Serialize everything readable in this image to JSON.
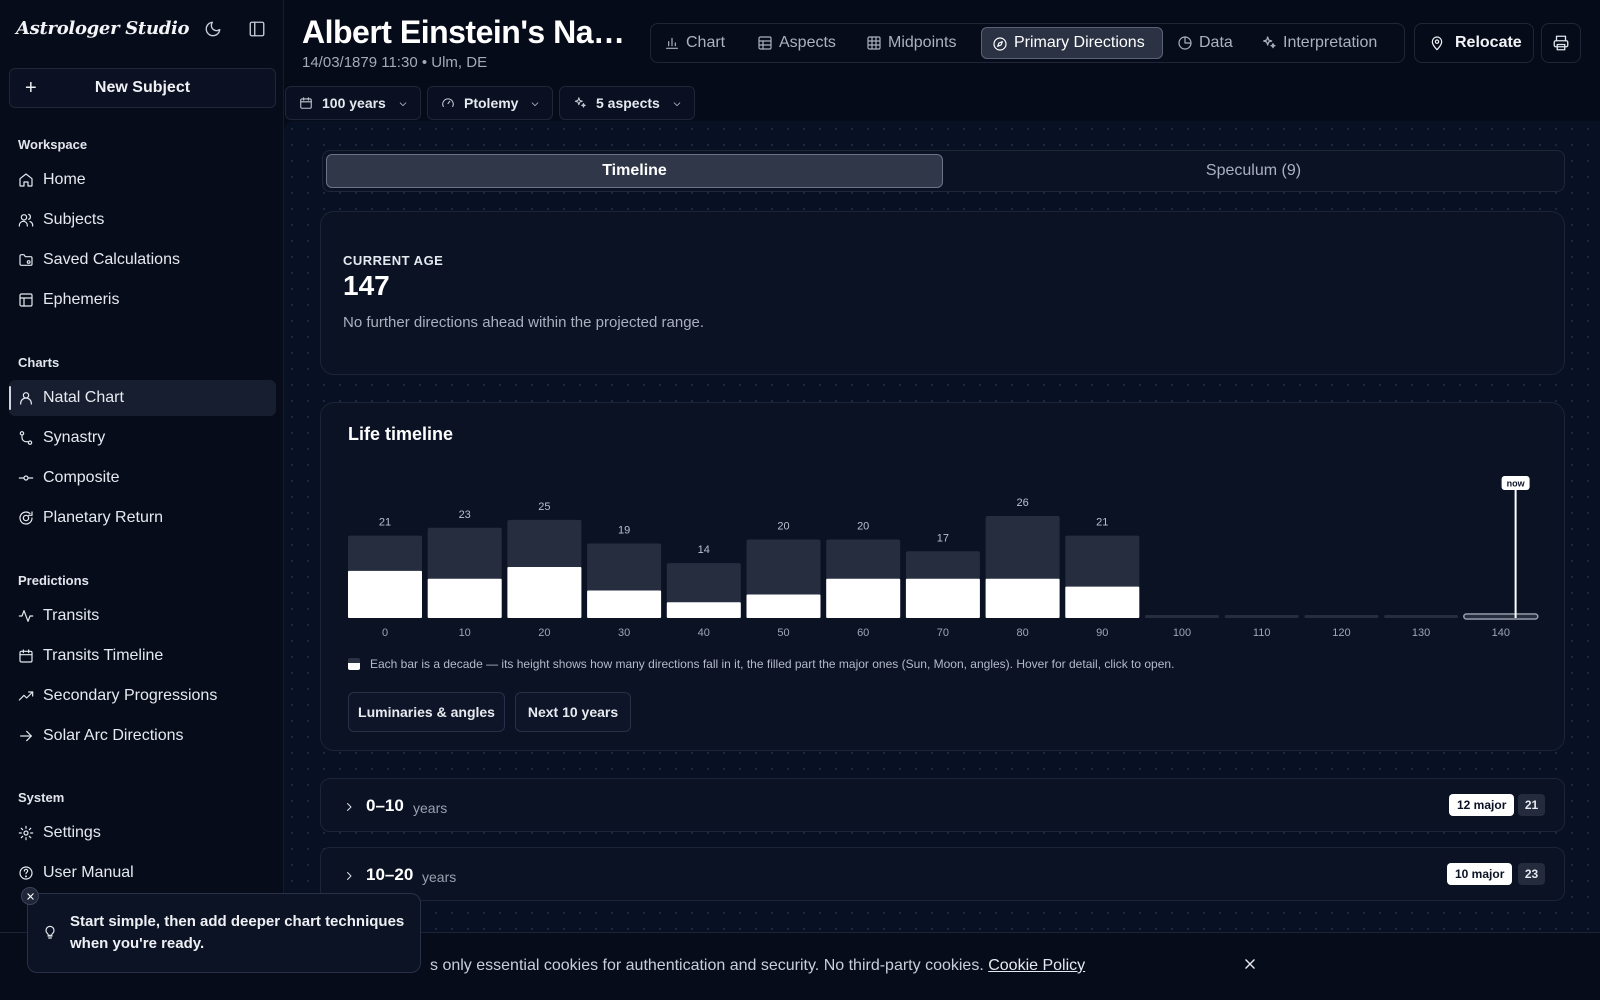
{
  "app": {
    "brand": "Astrologer Studio"
  },
  "sidebar": {
    "new_subject": "New Subject",
    "sections": {
      "workspace": "Workspace",
      "charts": "Charts",
      "predictions": "Predictions",
      "system": "System"
    },
    "workspace_items": [
      {
        "label": "Home",
        "icon": "home-icon"
      },
      {
        "label": "Subjects",
        "icon": "users-icon"
      },
      {
        "label": "Saved Calculations",
        "icon": "folder-icon"
      },
      {
        "label": "Ephemeris",
        "icon": "table-icon"
      }
    ],
    "chart_items": [
      {
        "label": "Natal Chart",
        "icon": "user-icon",
        "active": true
      },
      {
        "label": "Synastry",
        "icon": "branch-icon"
      },
      {
        "label": "Composite",
        "icon": "commit-icon"
      },
      {
        "label": "Planetary Return",
        "icon": "target-icon"
      }
    ],
    "prediction_items": [
      {
        "label": "Transits",
        "icon": "pulse-icon"
      },
      {
        "label": "Transits Timeline",
        "icon": "calendar-icon"
      },
      {
        "label": "Secondary Progressions",
        "icon": "trend-icon"
      },
      {
        "label": "Solar Arc Directions",
        "icon": "arrow-right-icon"
      }
    ],
    "system_items": [
      {
        "label": "Settings",
        "icon": "gear-icon"
      },
      {
        "label": "User Manual",
        "icon": "help-icon"
      }
    ]
  },
  "header": {
    "title": "Albert Einstein's Natal Chart",
    "subtitle": "14/03/1879 11:30 • Ulm, DE",
    "tabs": [
      {
        "label": "Chart",
        "icon": "bar-chart-icon"
      },
      {
        "label": "Aspects",
        "icon": "grid-icon"
      },
      {
        "label": "Midpoints",
        "icon": "grid-icon"
      },
      {
        "label": "Primary Directions",
        "icon": "compass-icon",
        "active": true
      },
      {
        "label": "Data",
        "icon": "pie-icon"
      },
      {
        "label": "Interpretation",
        "icon": "sparkles-icon"
      }
    ],
    "relocate": "Relocate"
  },
  "filters": {
    "range": "100 years",
    "method": "Ptolemy",
    "aspects": "5 aspects"
  },
  "view_toggle": {
    "timeline": "Timeline",
    "speculum": "Speculum (9)"
  },
  "current_age": {
    "label": "CURRENT AGE",
    "value": "147",
    "message": "No further directions ahead within the projected range."
  },
  "life_timeline": {
    "title": "Life timeline",
    "now_label": "now",
    "legend": "Each bar is a decade — its height shows how many directions fall in it, the filled part the major ones (Sun, Moon, angles). Hover for detail, click to open.",
    "buttons": {
      "luminaries": "Luminaries & angles",
      "next10": "Next 10 years"
    }
  },
  "chart_data": {
    "type": "bar",
    "categories": [
      "0",
      "10",
      "20",
      "30",
      "40",
      "50",
      "60",
      "70",
      "80",
      "90",
      "100",
      "110",
      "120",
      "130",
      "140"
    ],
    "series": [
      {
        "values": [
          21,
          23,
          25,
          19,
          14,
          20,
          20,
          17,
          26,
          21,
          0,
          0,
          0,
          0,
          0
        ]
      },
      {
        "values": [
          12,
          10,
          13,
          7,
          4,
          6,
          10,
          10,
          10,
          8,
          0,
          0,
          0,
          0,
          0
        ]
      }
    ],
    "marker": {
      "label": "now",
      "x": 147
    }
  },
  "decades": [
    {
      "range": "0–10",
      "unit": "years",
      "major": "12 major",
      "count": "21"
    },
    {
      "range": "10–20",
      "unit": "years",
      "major": "10 major",
      "count": "23"
    }
  ],
  "toast": {
    "message": "Start simple, then add deeper chart techniques when you're ready."
  },
  "cookie": {
    "text": "s only essential cookies for authentication and security. No third-party cookies.",
    "link": "Cookie Policy"
  },
  "colors": {
    "background": "#060b19",
    "panel": "#0b1224",
    "bar_total": "#252d3f",
    "bar_major": "#ffffff"
  }
}
